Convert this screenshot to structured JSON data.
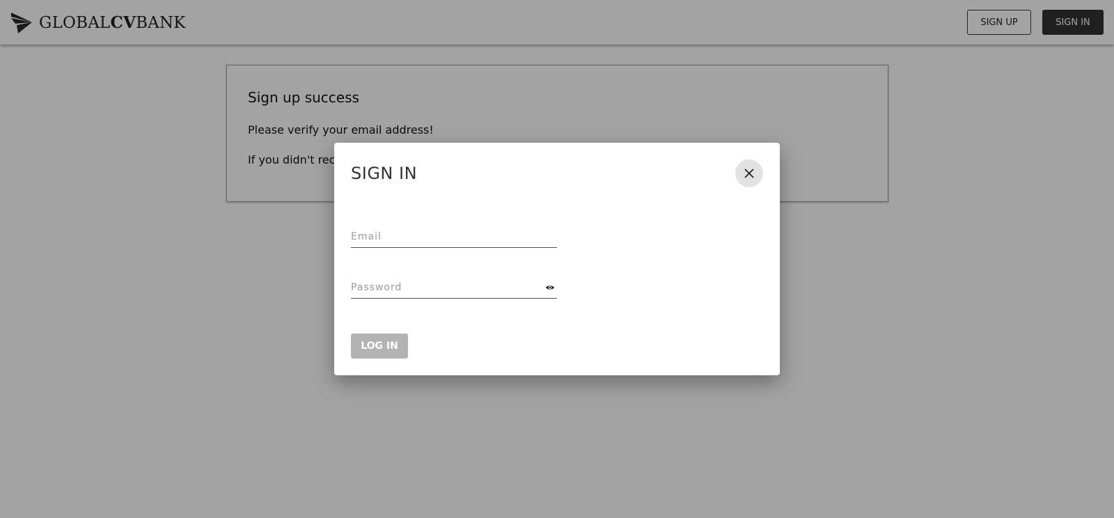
{
  "header": {
    "logo": {
      "prefix": "GLOBAL",
      "bold": "CV",
      "suffix": "BANK",
      "icon": "paper-plane-icon"
    },
    "signup_label": "SIGN UP",
    "signin_label": "SIGN IN"
  },
  "card": {
    "title": "Sign up success",
    "line1": "Please verify your email address!",
    "line2": "If you didn't rec"
  },
  "modal": {
    "title": "SIGN IN",
    "close_icon": "close-icon",
    "email_placeholder": "Email",
    "password_placeholder": "Password",
    "eye_icon": "eye-icon",
    "login_label": "LOG IN"
  },
  "colors": {
    "overlay": "rgba(0,0,0,0.36)",
    "primary_dark": "#333333",
    "disabled_button": "#b3b3b3",
    "close_button_bg": "#e2e2e2"
  }
}
